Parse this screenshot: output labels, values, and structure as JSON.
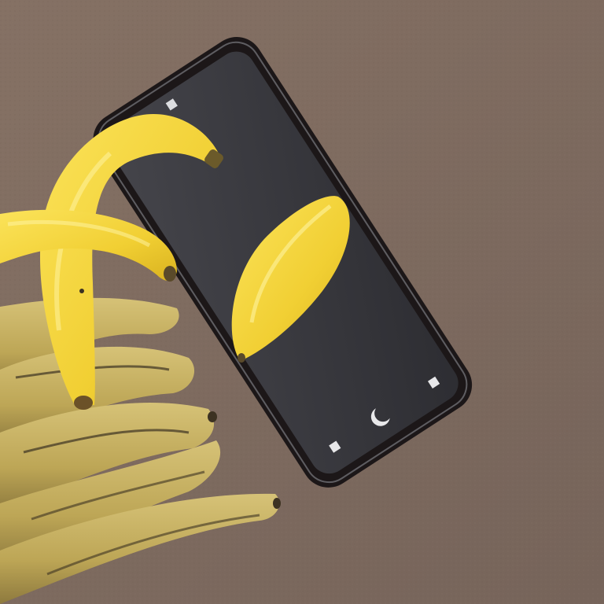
{
  "scene": {
    "surface": {
      "color": "#7d6a5e",
      "texture": "leather"
    },
    "phone": {
      "frame_color": "#1c1718",
      "screen_color": "#3a3a3f",
      "icons": [
        "camera-dot-icon",
        "sensor-square-icon",
        "square-icon",
        "crescent-moon-icon",
        "square-icon"
      ]
    },
    "bananas": {
      "ripe_color": "#f3d43c",
      "overripe_color": "#c8b05a",
      "spot_color": "#3c3222"
    }
  }
}
